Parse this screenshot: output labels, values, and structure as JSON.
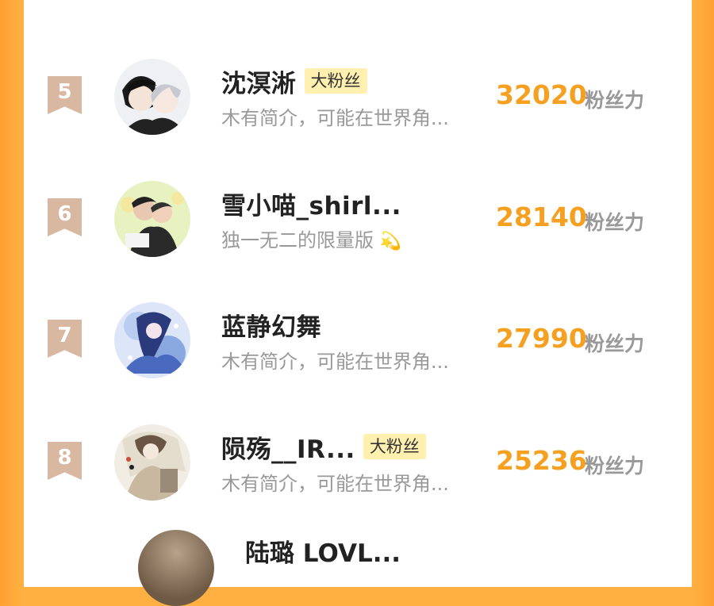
{
  "colors": {
    "page_bg": "#ffb040",
    "card_bg": "#ffffff",
    "rank_badge": "#d8b8a0",
    "score": "#f5a020",
    "muted": "#999999",
    "name": "#222222",
    "fan_badge_bg": "#fff0b0"
  },
  "rows": [
    {
      "rank": "5",
      "name": "沈溟淅",
      "badge": "大粉丝",
      "bio": "木有简介，可能在世界角...",
      "score": "32020",
      "score_unit": "粉丝力",
      "avatar_icon": "avatar-anime-couple"
    },
    {
      "rank": "6",
      "name": "雪小喵_shirl...",
      "badge": "",
      "bio": "独一无二的限量版",
      "bio_emoji_icon": "sparkle-icon",
      "score": "28140",
      "score_unit": "粉丝力",
      "avatar_icon": "avatar-couple-photo"
    },
    {
      "rank": "7",
      "name": "蓝静幻舞",
      "badge": "",
      "bio": "木有简介，可能在世界角...",
      "score": "27990",
      "score_unit": "粉丝力",
      "avatar_icon": "avatar-blue-anime"
    },
    {
      "rank": "8",
      "name": "陨殇__IR...",
      "badge": "大粉丝",
      "bio": "木有简介，可能在世界角...",
      "score": "25236",
      "score_unit": "粉丝力",
      "avatar_icon": "avatar-sepia-anime"
    }
  ],
  "partial_next_row": {
    "name": "陆璐 LOVL..."
  }
}
